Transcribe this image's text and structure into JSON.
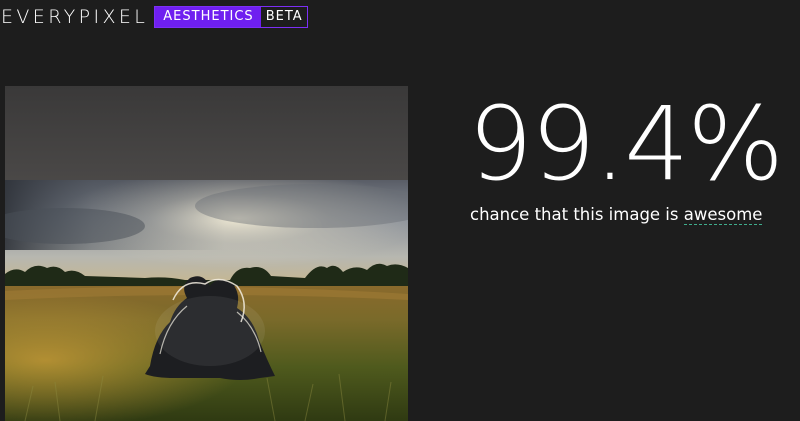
{
  "header": {
    "brand": "EVERYPIXEL",
    "product": "AESTHETICS",
    "tag": "BETA"
  },
  "result": {
    "score": "99.4%",
    "caption_prefix": "chance that this image is",
    "caption_keyword": "awesome"
  },
  "colors": {
    "background": "#1d1d1d",
    "accent": "#6f1ff0",
    "keyword_underline": "#3fae8d"
  }
}
